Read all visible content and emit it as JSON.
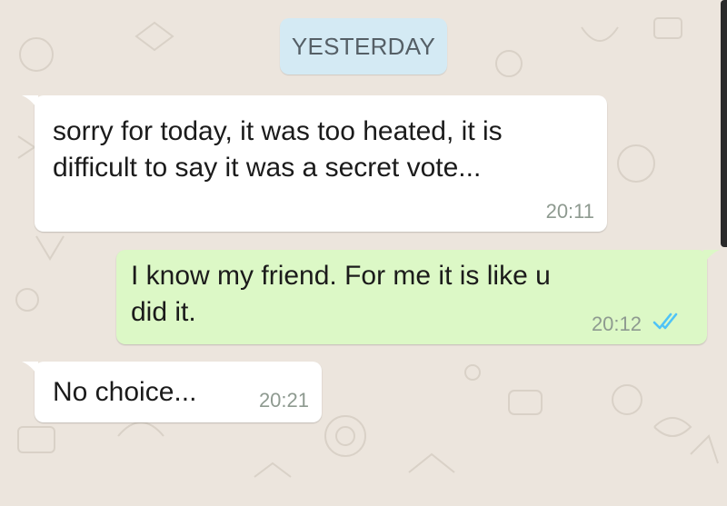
{
  "chat": {
    "date_separator": "YESTERDAY",
    "messages": [
      {
        "direction": "incoming",
        "line1": "sorry for today, it was too heated, it is",
        "line2": "difficult to say it was a secret vote...",
        "time": "20:11"
      },
      {
        "direction": "outgoing",
        "line1": "I know my friend. For me it is like u",
        "line2": "did it.",
        "time": "20:12",
        "status": "double-check-read-icon"
      },
      {
        "direction": "incoming",
        "line1": "No choice...",
        "time": "20:21"
      }
    ]
  },
  "colors": {
    "background": "#ece5dd",
    "incoming_bubble": "#ffffff",
    "outgoing_bubble": "#dcf8c6",
    "date_chip": "#d4eaf4",
    "read_ticks": "#4fc3f7"
  }
}
